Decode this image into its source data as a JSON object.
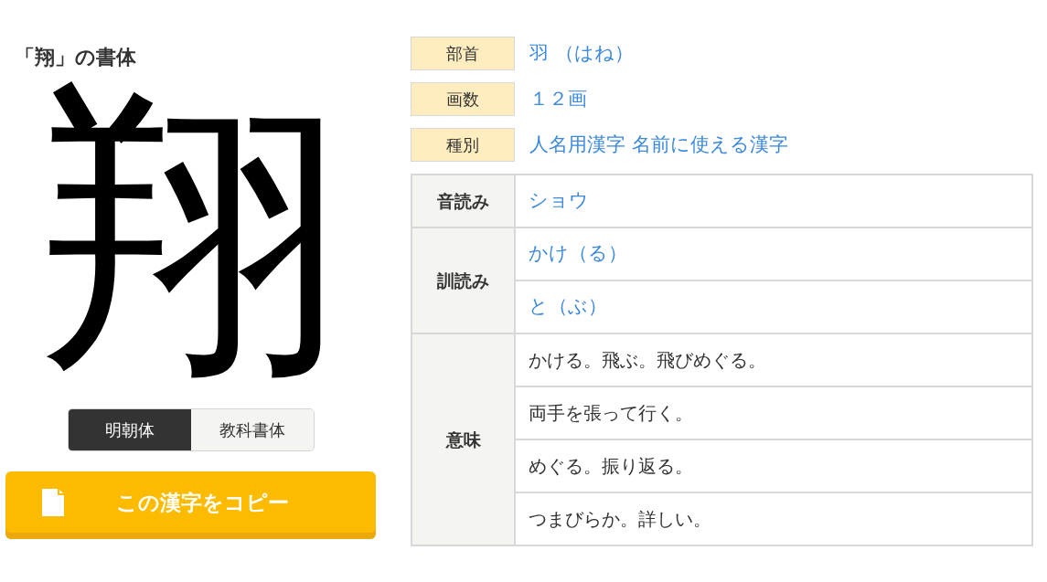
{
  "title": "「翔」の書体",
  "kanji": "翔",
  "font_tabs": [
    {
      "label": "明朝体",
      "selected": true
    },
    {
      "label": "教科書体",
      "selected": false
    }
  ],
  "copy_button": "この漢字をコピー",
  "info": [
    {
      "label": "部首",
      "value": "羽 （はね）"
    },
    {
      "label": "画数",
      "value": "１２画"
    },
    {
      "label": "種別",
      "value": "人名用漢字 名前に使える漢字"
    }
  ],
  "readings": [
    {
      "label": "音読み",
      "kind": "link",
      "values": [
        "ショウ"
      ]
    },
    {
      "label": "訓読み",
      "kind": "link",
      "values": [
        "かけ（る）",
        "と（ぶ）"
      ]
    },
    {
      "label": "意味",
      "kind": "text",
      "values": [
        "かける。飛ぶ。飛びめぐる。",
        "両手を張って行く。",
        "めぐる。振り返る。",
        "つまびらか。詳しい。"
      ]
    }
  ]
}
